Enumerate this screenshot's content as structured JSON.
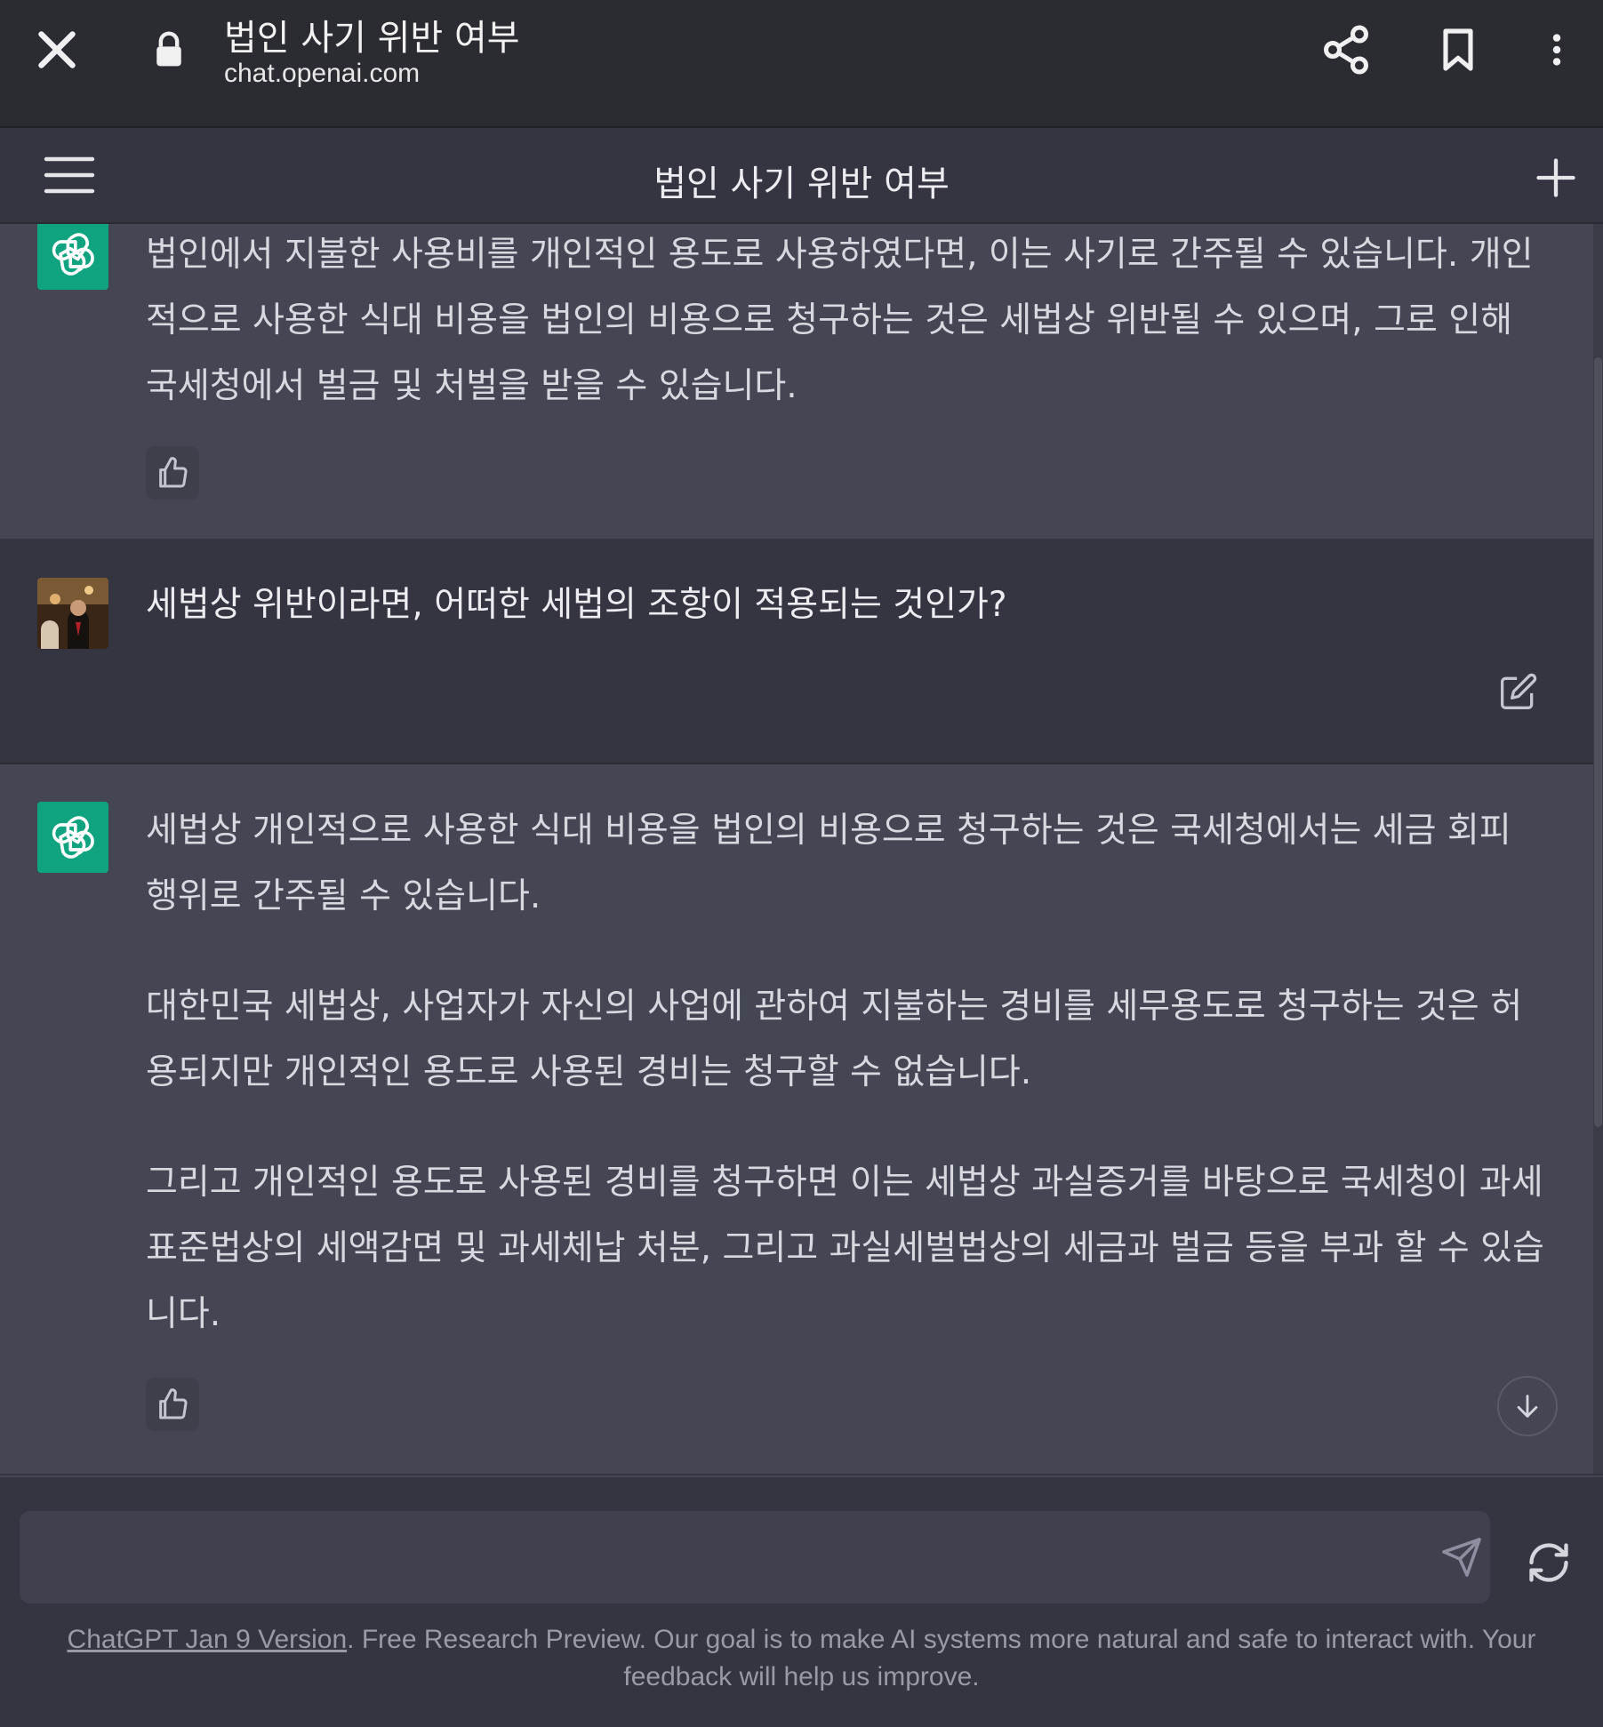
{
  "browser": {
    "page_title": "법인 사기 위반 여부",
    "url": "chat.openai.com"
  },
  "app": {
    "title": "법인 사기 위반 여부"
  },
  "messages": [
    {
      "role": "assistant",
      "paragraphs": [
        "법인에서 지불한 사용비를 개인적인 용도로 사용하였다면, 이는 사기로 간주될 수 있습니다. 개인적으로 사용한 식대 비용을 법인의 비용으로 청구하는 것은 세법상 위반될 수 있으며, 그로 인해 국세청에서 벌금 및 처벌을 받을 수 있습니다."
      ]
    },
    {
      "role": "user",
      "paragraphs": [
        "세법상 위반이라면, 어떠한 세법의 조항이 적용되는 것인가?"
      ]
    },
    {
      "role": "assistant",
      "paragraphs": [
        "세법상 개인적으로 사용한 식대 비용을 법인의 비용으로 청구하는 것은 국세청에서는 세금 회피 행위로 간주될 수 있습니다.",
        "대한민국 세법상, 사업자가 자신의 사업에 관하여 지불하는 경비를 세무용도로 청구하는 것은 허용되지만 개인적인 용도로 사용된 경비는 청구할 수 없습니다.",
        "그리고 개인적인 용도로 사용된 경비를 청구하면 이는 세법상 과실증거를 바탕으로 국세청이 과세표준법상의 세액감면 및 과세체납 처분, 그리고 과실세벌법상의 세금과 벌금 등을 부과 할 수 있습니다."
      ]
    }
  ],
  "composer": {
    "placeholder": "",
    "value": ""
  },
  "footer": {
    "version_link": "ChatGPT Jan 9 Version",
    "text": ". Free Research Preview. Our goal is to make AI systems more natural and safe to interact with. Your feedback will help us improve."
  },
  "icons": {
    "close": "close-icon",
    "lock": "lock-icon",
    "share": "share-icon",
    "bookmark": "bookmark-icon",
    "more": "more-vert-icon",
    "menu": "hamburger-menu-icon",
    "new_chat": "plus-icon",
    "assistant_avatar": "openai-logo-icon",
    "thumbs_up": "thumbs-up-icon",
    "edit": "edit-icon",
    "scroll_down": "arrow-down-icon",
    "send": "send-icon",
    "regenerate": "refresh-icon"
  },
  "colors": {
    "assistant_bg": "#444654",
    "user_bg": "#343541",
    "brand_green": "#10a37f",
    "chrome_bg": "#2b2c32"
  }
}
